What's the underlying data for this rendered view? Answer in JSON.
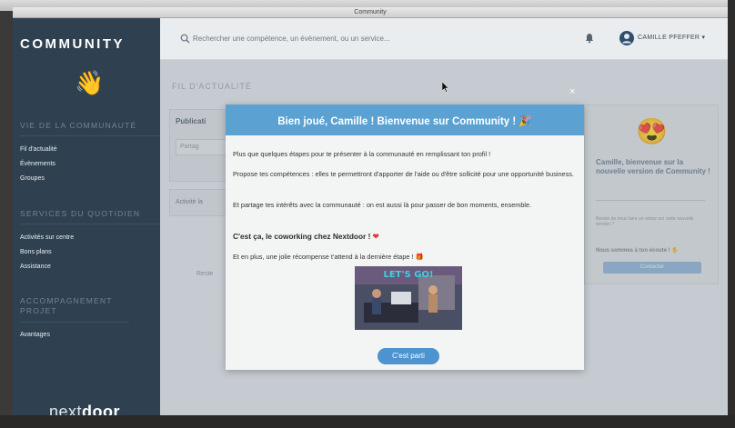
{
  "window": {
    "title": "Community"
  },
  "sidebar": {
    "brand": "COMMUNITY",
    "sections": [
      {
        "title": "VIE DE LA COMMUNAUTÉ",
        "items": [
          "Fil d'actualité",
          "Évènements",
          "Groupes"
        ]
      },
      {
        "title": "SERVICES DU QUOTIDIEN",
        "items": [
          "Activités sur centre",
          "Bons plans",
          "Assistance"
        ]
      },
      {
        "title": "ACCOMPAGNEMENT PROJET",
        "items": [
          "Avantages"
        ]
      }
    ],
    "logo_light": "next",
    "logo_bold": "door"
  },
  "topbar": {
    "search_placeholder": "Rechercher une compétence, un évènement, ou un service...",
    "user_name": "CAMILLE PFEFFER ▾"
  },
  "page": {
    "heading": "FIL D'ACTUALITÉ",
    "publication_label": "Publicati",
    "partager_label": "Partag",
    "activite_label": "Activité la",
    "reste_label": "Reste"
  },
  "right_card": {
    "welcome": "Camille, bienvenue sur la nouvelle version de Community !",
    "retour": "Besoin de nous faire un retour sur cette nouvelle version ?",
    "ecoute": "Nous sommes à ton écoute ! ✋",
    "button": "Contacter"
  },
  "modal": {
    "title": "Bien joué,  Camille  ! Bienvenue sur Community ! 🎉",
    "p1": "Plus que quelques étapes pour te présenter à la communauté en remplissant ton profil !",
    "p2": "Propose tes compétences : elles te permettront d'apporter de l'aide ou d'être sollicité pour une opportunité business.",
    "p3": "Et partage tes intérêts avec la communauté : on est aussi là pour passer de bon moments, ensemble.",
    "p4": "C'est ça, le coworking chez Nextdoor !",
    "p5": "Et en plus, une jolie récompense t'attend à la dernière étape !",
    "gif_text": "LET'S GO!",
    "cta": "C'est parti",
    "close": "×"
  },
  "colors": {
    "sidebar_bg": "#2f4150",
    "modal_header": "#5ba2d2",
    "cta": "#4d93cf"
  }
}
